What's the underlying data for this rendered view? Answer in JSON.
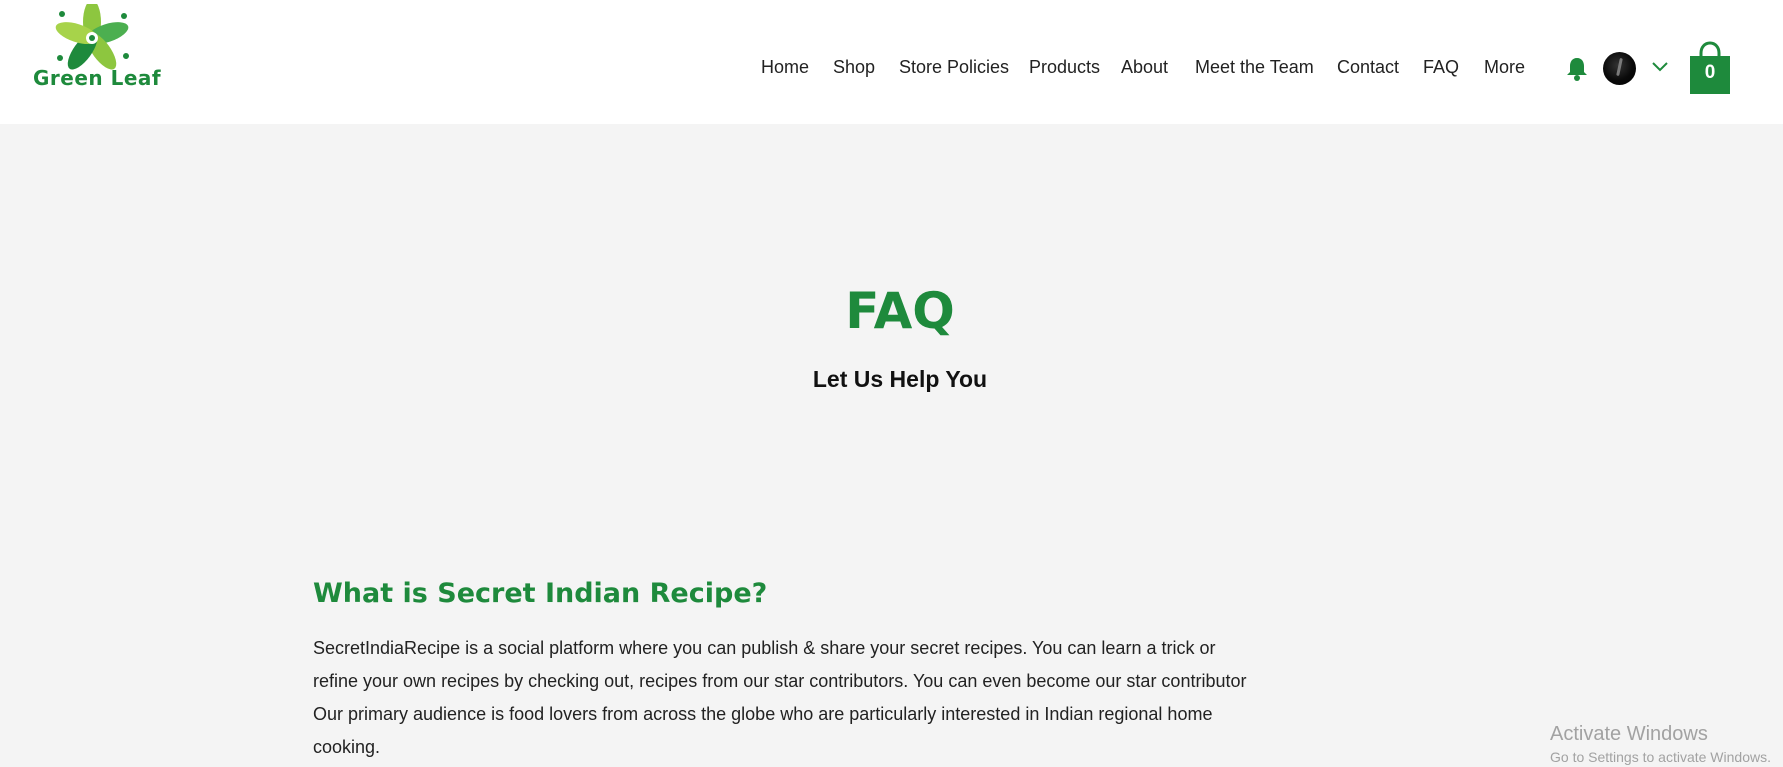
{
  "header": {
    "logo_text": "Green Leaf",
    "nav": [
      {
        "label": "Home"
      },
      {
        "label": "Shop"
      },
      {
        "label": "Store Policies"
      },
      {
        "label": "Products"
      },
      {
        "label": "About"
      },
      {
        "label": "Meet the Team"
      },
      {
        "label": "Contact"
      },
      {
        "label": "FAQ"
      },
      {
        "label": "More"
      }
    ],
    "cart_count": "0",
    "icons": {
      "notifications": "bell-icon",
      "account_menu": "chevron-down-icon",
      "cart": "shopping-bag-icon"
    }
  },
  "hero": {
    "title": "FAQ",
    "subtitle": "Let Us Help You"
  },
  "faq": {
    "question": "What is Secret Indian Recipe?",
    "answer_lines": [
      "SecretIndiaRecipe is a social platform where you can publish & share your secret recipes. You can learn a trick or",
      "refine your own recipes by checking out, recipes from our star contributors. You can even become our star contributor",
      "Our primary audience is food lovers from across the globe who are particularly interested in Indian regional home",
      "cooking."
    ]
  },
  "watermark": {
    "title": "Activate Windows",
    "subtitle": "Go to Settings to activate Windows."
  },
  "colors": {
    "brand_green": "#1e8a3c",
    "page_bg": "#f4f4f4",
    "header_bg": "#ffffff"
  }
}
